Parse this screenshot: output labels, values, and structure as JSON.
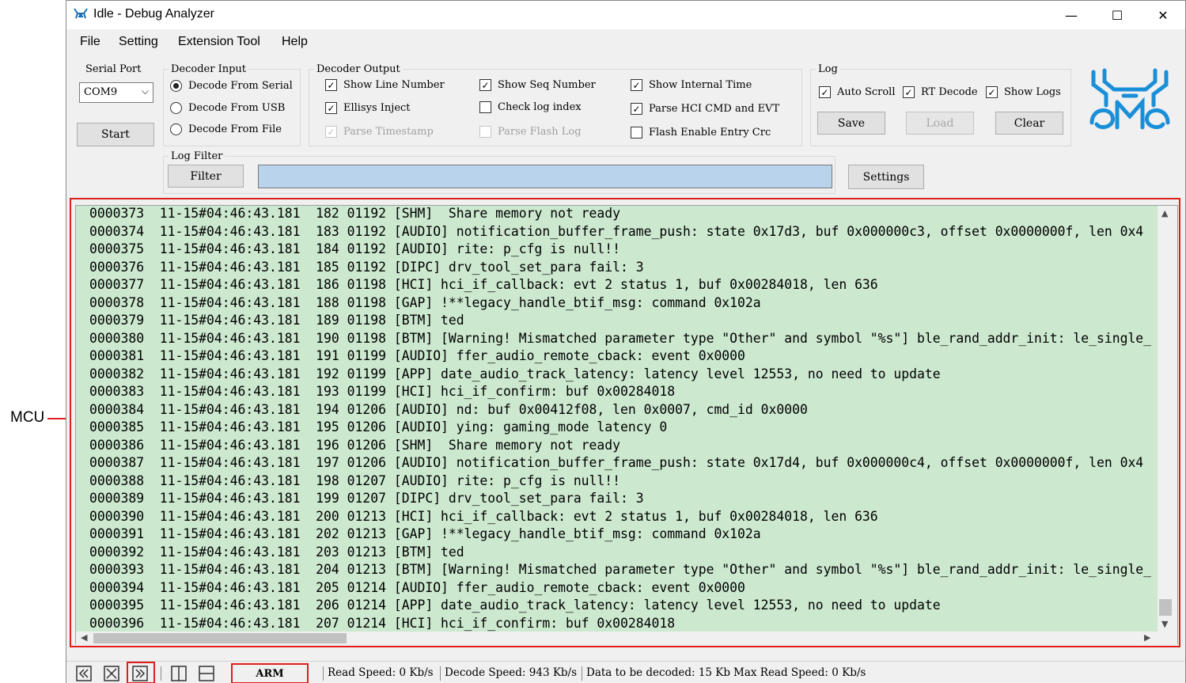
{
  "annotation": {
    "label": "MCU",
    "color": "#e01e1e"
  },
  "window": {
    "title": "Idle - Debug Analyzer",
    "controls": {
      "minimize": "—",
      "maximize": "☐",
      "close": "✕"
    }
  },
  "menu": [
    "File",
    "Setting",
    "Extension Tool",
    "Help"
  ],
  "serial_port": {
    "title": "Serial Port",
    "selected": "COM9",
    "start_label": "Start"
  },
  "decoder_input": {
    "title": "Decoder Input",
    "options": [
      {
        "label": "Decode From Serial",
        "selected": true
      },
      {
        "label": "Decode From USB",
        "selected": false
      },
      {
        "label": "Decode From File",
        "selected": false
      }
    ]
  },
  "decoder_output": {
    "title": "Decoder Output",
    "options": [
      {
        "label": "Show Line Number",
        "checked": true,
        "enabled": true
      },
      {
        "label": "Show Seq Number",
        "checked": true,
        "enabled": true
      },
      {
        "label": "Show Internal Time",
        "checked": true,
        "enabled": true
      },
      {
        "label": "Ellisys Inject",
        "checked": true,
        "enabled": true
      },
      {
        "label": "Check log index",
        "checked": false,
        "enabled": true
      },
      {
        "label": "Parse HCI CMD and EVT",
        "checked": true,
        "enabled": true
      },
      {
        "label": "Parse Timestamp",
        "checked": true,
        "enabled": false
      },
      {
        "label": "Parse Flash Log",
        "checked": false,
        "enabled": false
      },
      {
        "label": "Flash Enable Entry Crc",
        "checked": false,
        "enabled": true
      }
    ]
  },
  "log_group": {
    "title": "Log",
    "options": [
      {
        "label": "Auto Scroll",
        "checked": true
      },
      {
        "label": "RT Decode",
        "checked": true
      },
      {
        "label": "Show Logs",
        "checked": true
      }
    ],
    "buttons": [
      {
        "label": "Save",
        "enabled": true
      },
      {
        "label": "Load",
        "enabled": false
      },
      {
        "label": "Clear",
        "enabled": true
      }
    ]
  },
  "log_filter": {
    "title": "Log Filter",
    "filter_label": "Filter",
    "input_value": "",
    "settings_label": "Settings"
  },
  "log_lines": [
    "0000373  11-15#04:46:43.181  182 01192 [SHM]  Share memory not ready",
    "0000374  11-15#04:46:43.181  183 01192 [AUDIO] notification_buffer_frame_push: state 0x17d3, buf 0x000000c3, offset 0x0000000f, len 0x4",
    "0000375  11-15#04:46:43.181  184 01192 [AUDIO] rite: p_cfg is null!!",
    "0000376  11-15#04:46:43.181  185 01192 [DIPC] drv_tool_set_para fail: 3",
    "0000377  11-15#04:46:43.181  186 01198 [HCI] hci_if_callback: evt 2 status 1, buf 0x00284018, len 636",
    "0000378  11-15#04:46:43.181  188 01198 [GAP] !**legacy_handle_btif_msg: command 0x102a",
    "0000379  11-15#04:46:43.181  189 01198 [BTM] ted",
    "0000380  11-15#04:46:43.181  190 01198 [BTM] [Warning! Mismatched parameter type \"Other\" and symbol \"%s\"] ble_rand_addr_init: le_single_",
    "0000381  11-15#04:46:43.181  191 01199 [AUDIO] ffer_audio_remote_cback: event 0x0000",
    "0000382  11-15#04:46:43.181  192 01199 [APP] date_audio_track_latency: latency level 12553, no need to update",
    "0000383  11-15#04:46:43.181  193 01199 [HCI] hci_if_confirm: buf 0x00284018",
    "0000384  11-15#04:46:43.181  194 01206 [AUDIO] nd: buf 0x00412f08, len 0x0007, cmd_id 0x0000",
    "0000385  11-15#04:46:43.181  195 01206 [AUDIO] ying: gaming_mode latency 0",
    "0000386  11-15#04:46:43.181  196 01206 [SHM]  Share memory not ready",
    "0000387  11-15#04:46:43.181  197 01206 [AUDIO] notification_buffer_frame_push: state 0x17d4, buf 0x000000c4, offset 0x0000000f, len 0x4",
    "0000388  11-15#04:46:43.181  198 01207 [AUDIO] rite: p_cfg is null!!",
    "0000389  11-15#04:46:43.181  199 01207 [DIPC] drv_tool_set_para fail: 3",
    "0000390  11-15#04:46:43.181  200 01213 [HCI] hci_if_callback: evt 2 status 1, buf 0x00284018, len 636",
    "0000391  11-15#04:46:43.181  202 01213 [GAP] !**legacy_handle_btif_msg: command 0x102a",
    "0000392  11-15#04:46:43.181  203 01213 [BTM] ted",
    "0000393  11-15#04:46:43.181  204 01213 [BTM] [Warning! Mismatched parameter type \"Other\" and symbol \"%s\"] ble_rand_addr_init: le_single_",
    "0000394  11-15#04:46:43.181  205 01214 [AUDIO] ffer_audio_remote_cback: event 0x0000",
    "0000395  11-15#04:46:43.181  206 01214 [APP] date_audio_track_latency: latency level 12553, no need to update",
    "0000396  11-15#04:46:43.181  207 01214 [HCI] hci_if_confirm: buf 0x00284018"
  ],
  "statusbar": {
    "mode": "ARM",
    "read_speed": "Read Speed:  0 Kb/s",
    "decode_speed": "Decode Speed:  943 Kb/s",
    "data_to_decode": "Data to be decoded:  15 Kb",
    "max_read_speed": "Max Read Speed:  0 Kb/s"
  },
  "colors": {
    "log_background": "#cce8cf",
    "highlight": "#e01e1e",
    "filter_input": "#b9d3ec"
  },
  "icons": [
    "app-icon",
    "brand-logo-icon",
    "first-page-icon",
    "stop-icon",
    "last-page-icon",
    "split-vertical-icon",
    "split-horizontal-icon"
  ]
}
